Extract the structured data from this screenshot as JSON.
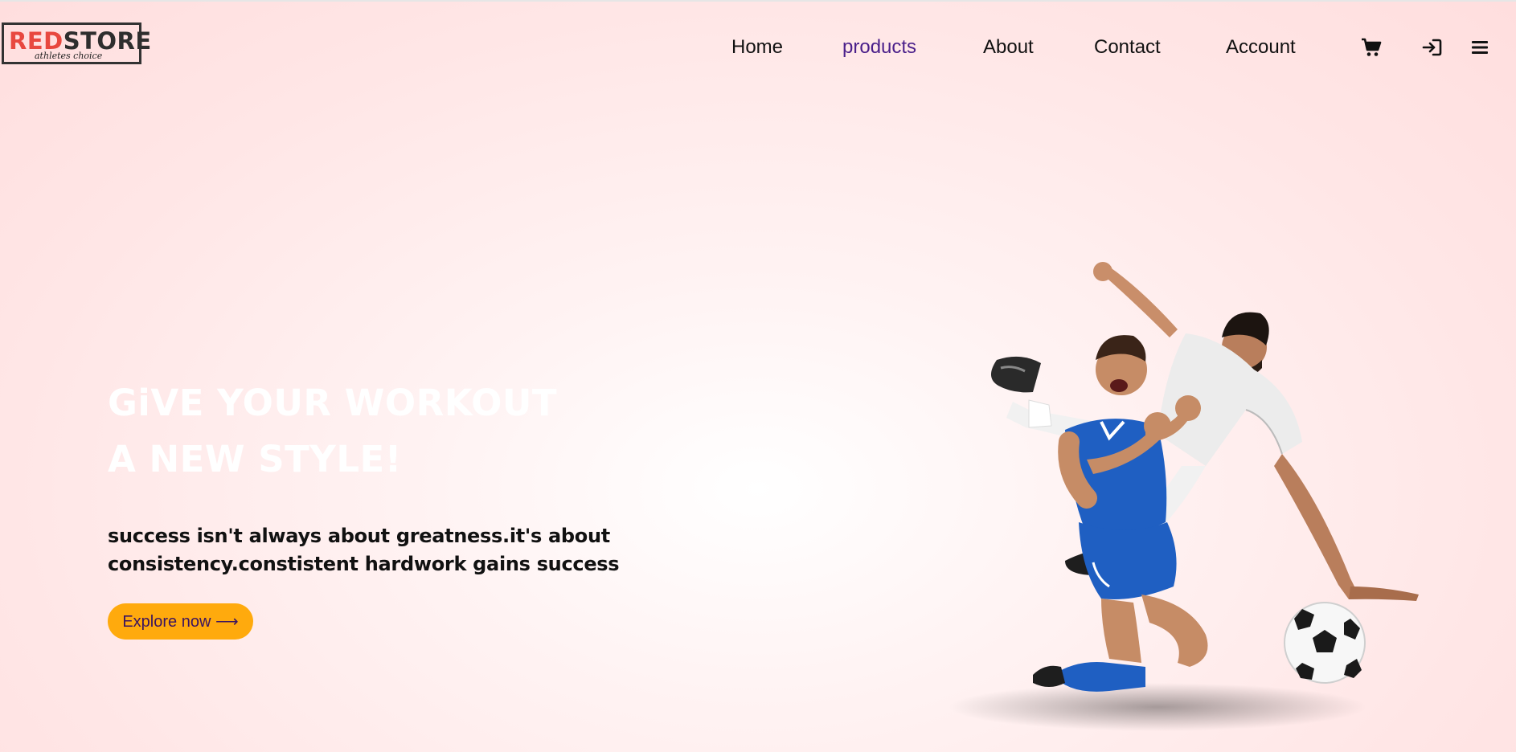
{
  "logo": {
    "red_part": "RED",
    "dark_part": "STORE",
    "tagline": "athletes choice"
  },
  "nav": {
    "items": [
      {
        "label": "Home"
      },
      {
        "label": "products",
        "active": true
      },
      {
        "label": "About"
      },
      {
        "label": "Contact"
      },
      {
        "label": "Account"
      }
    ],
    "icons": [
      "cart-icon",
      "sign-in-icon",
      "menu-icon"
    ]
  },
  "hero": {
    "title_line1": "GiVE YOUR WORKOUT",
    "title_line2": "A NEW STYLE!",
    "tagline_line1": "success isn't always about greatness.it's about",
    "tagline_line2": "consistency.constistent hardwork gains success",
    "cta_label": "Explore now ⟶"
  },
  "colors": {
    "brand_red": "#e8483f",
    "active_nav": "#4a1f8a",
    "cta_bg": "#ffaa0d",
    "background": "#ffe6e6"
  }
}
